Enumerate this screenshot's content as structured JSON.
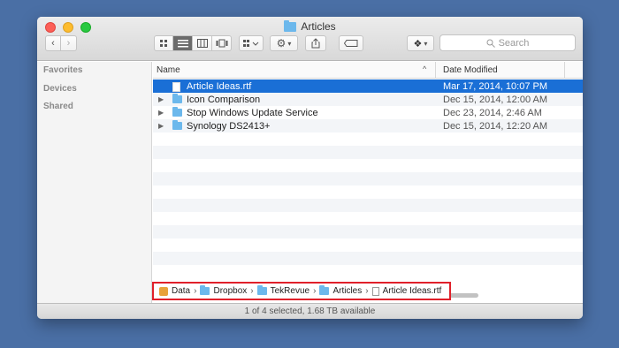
{
  "window": {
    "title": "Articles"
  },
  "toolbar": {
    "back": "‹",
    "forward": "›",
    "search_placeholder": "Search"
  },
  "sidebar": {
    "items": [
      {
        "label": "Favorites"
      },
      {
        "label": "Devices"
      },
      {
        "label": "Shared"
      }
    ]
  },
  "columns": {
    "name": "Name",
    "date": "Date Modified"
  },
  "files": [
    {
      "name": "Article Ideas.rtf",
      "date": "Mar 17, 2014, 10:07 PM",
      "type": "file",
      "selected": true
    },
    {
      "name": "Icon Comparison",
      "date": "Dec 15, 2014, 12:00 AM",
      "type": "folder",
      "selected": false
    },
    {
      "name": "Stop Windows Update Service",
      "date": "Dec 23, 2014, 2:46 AM",
      "type": "folder",
      "selected": false
    },
    {
      "name": "Synology DS2413+",
      "date": "Dec 15, 2014, 12:20 AM",
      "type": "folder",
      "selected": false
    }
  ],
  "path": [
    "Data",
    "Dropbox",
    "TekRevue",
    "Articles",
    "Article Ideas.rtf"
  ],
  "status": "1 of 4 selected, 1.68 TB available",
  "colors": {
    "selection": "#1a6fd6",
    "highlight_border": "#e0202a",
    "folder": "#6cb8ec"
  }
}
